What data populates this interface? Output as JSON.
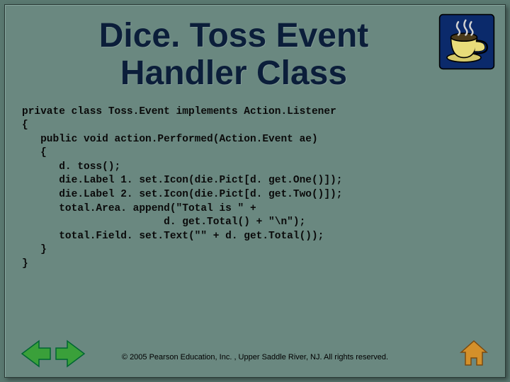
{
  "title": "Dice. Toss Event Handler Class",
  "code": "private class Toss.Event implements Action.Listener\n{\n   public void action.Performed(Action.Event ae)\n   {\n      d. toss();\n      die.Label 1. set.Icon(die.Pict[d. get.One()]);\n      die.Label 2. set.Icon(die.Pict[d. get.Two()]);\n      total.Area. append(\"Total is \" +\n                       d. get.Total() + \"\\n\");\n      total.Field. set.Text(\"\" + d. get.Total());\n   }\n}",
  "footer": "© 2005 Pearson Education, Inc. , Upper Saddle River, NJ.  All rights reserved.",
  "icons": {
    "coffee": "coffee-cup-icon",
    "left": "arrow-left-icon",
    "right": "arrow-right-icon",
    "home": "home-icon"
  }
}
